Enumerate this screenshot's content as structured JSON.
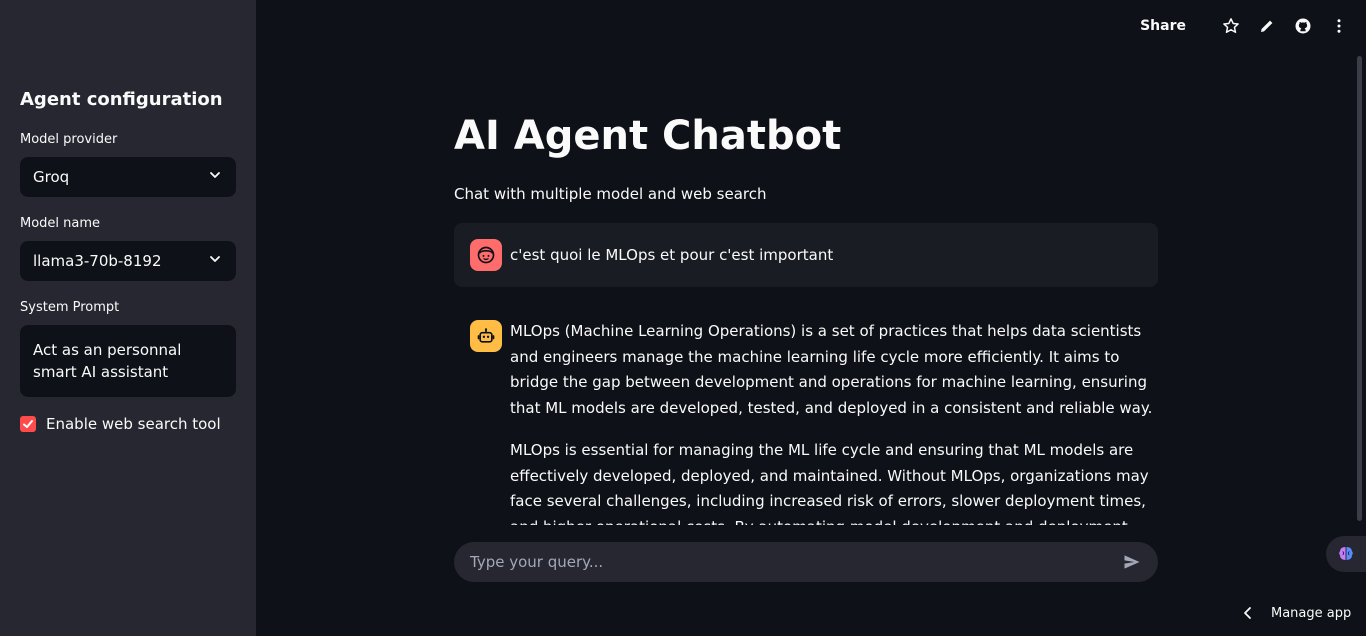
{
  "sidebar": {
    "title": "Agent configuration",
    "model_provider_label": "Model provider",
    "model_provider_value": "Groq",
    "model_name_label": "Model name",
    "model_name_value": "llama3-70b-8192",
    "system_prompt_label": "System Prompt",
    "system_prompt_value": "Act as an personnal smart AI assistant",
    "web_search_label": "Enable web search tool",
    "web_search_checked": true
  },
  "topbar": {
    "share_label": "Share"
  },
  "main": {
    "title": "AI Agent Chatbot",
    "subtitle": "Chat with multiple model and web search"
  },
  "messages": [
    {
      "role": "user",
      "text": "c'est quoi le MLOps et pour c'est important"
    },
    {
      "role": "assistant",
      "paragraphs": [
        "MLOps (Machine Learning Operations) is a set of practices that helps data scientists and engineers manage the machine learning life cycle more efficiently. It aims to bridge the gap between development and operations for machine learning, ensuring that ML models are developed, tested, and deployed in a consistent and reliable way.",
        "MLOps is essential for managing the ML life cycle and ensuring that ML models are effectively developed, deployed, and maintained. Without MLOps, organizations may face several challenges, including increased risk of errors, slower deployment times, and higher operational costs. By automating model development and deployment with MLOps, organizations can"
      ]
    }
  ],
  "chat_input": {
    "placeholder": "Type your query..."
  },
  "footer": {
    "manage_label": "Manage app"
  },
  "colors": {
    "accent": "#ff4b4b",
    "user_avatar": "#ff6c6c",
    "assistant_avatar": "#ffbd45",
    "sidebar_bg": "#262730",
    "main_bg": "#0e1117"
  }
}
